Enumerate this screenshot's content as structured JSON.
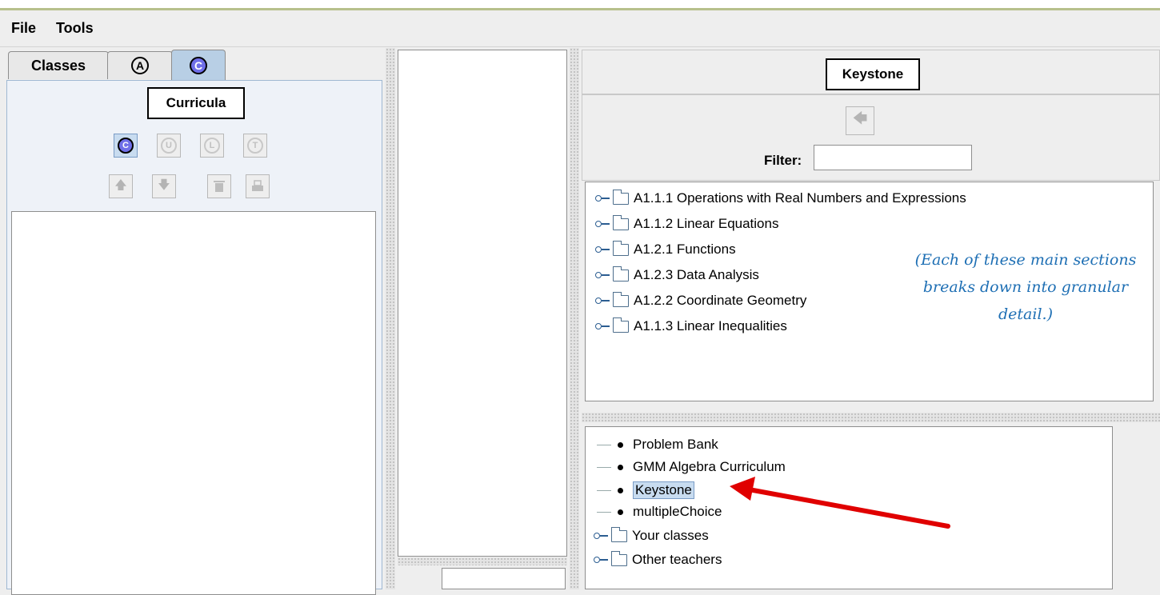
{
  "menu": {
    "file": "File",
    "tools": "Tools"
  },
  "tabs": [
    {
      "label": "Classes"
    },
    {
      "label": "A"
    },
    {
      "label": "C"
    }
  ],
  "left_panel": {
    "title": "Curricula",
    "mode_buttons": [
      "C",
      "U",
      "L",
      "T"
    ]
  },
  "right_panel": {
    "header_title": "Keystone",
    "filter_label": "Filter:",
    "filter_value": "",
    "tree_items": [
      "A1.1.1 Operations with Real Numbers and Expressions",
      "A1.1.2 Linear Equations",
      "A1.2.1 Functions",
      "A1.2.3 Data Analysis",
      "A1.2.2 Coordinate Geometry",
      "A1.1.3 Linear Inequalities"
    ],
    "annotation": "(Each of these main sections breaks down into granular detail.)",
    "curricula_list": [
      {
        "label": "Problem Bank",
        "kind": "bullet"
      },
      {
        "label": "GMM Algebra Curriculum",
        "kind": "bullet"
      },
      {
        "label": "Keystone",
        "kind": "bullet",
        "selected": true
      },
      {
        "label": "multipleChoice",
        "kind": "bullet"
      },
      {
        "label": "Your classes",
        "kind": "folder"
      },
      {
        "label": "Other teachers",
        "kind": "folder"
      }
    ]
  },
  "colors": {
    "accent_tab": "#b8cfe5",
    "annotation": "#1e6fb4",
    "arrow": "#e00000",
    "selection": "#c8dcf0"
  }
}
